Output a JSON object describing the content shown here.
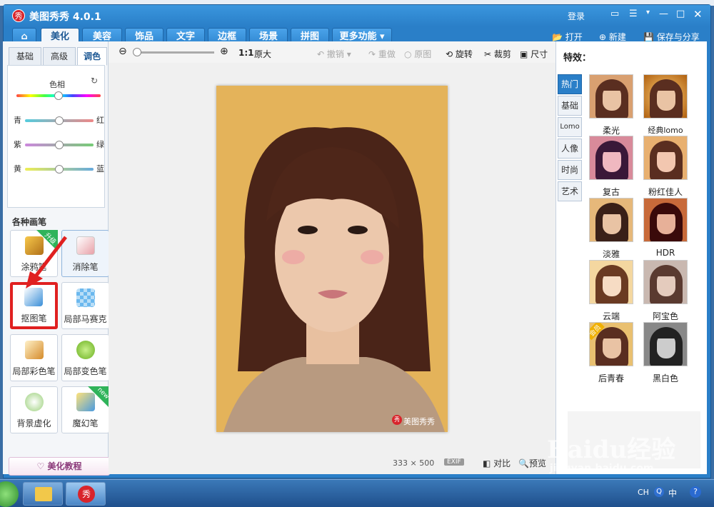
{
  "app": {
    "title": "美图秀秀 4.0.1",
    "logo_text": "秀",
    "login": "登录"
  },
  "tabs": [
    "美化",
    "美容",
    "饰品",
    "文字",
    "边框",
    "场景",
    "拼图",
    "更多功能"
  ],
  "toolbar": {
    "open": "打开",
    "new": "新建",
    "save": "保存与分享"
  },
  "left": {
    "subtabs": [
      "基础",
      "高级",
      "调色"
    ],
    "adjust": {
      "hue": "色相",
      "left1": "青",
      "right1": "红",
      "left2": "紫",
      "right2": "绿",
      "left3": "黄",
      "right3": "蓝"
    },
    "brush_title": "各种画笔",
    "brushes": [
      {
        "label": "涂鸦笔",
        "badge": "升级"
      },
      {
        "label": "消除笔",
        "badge": ""
      },
      {
        "label": "抠图笔",
        "badge": ""
      },
      {
        "label": "局部马赛克",
        "badge": ""
      },
      {
        "label": "局部彩色笔",
        "badge": ""
      },
      {
        "label": "局部变色笔",
        "badge": ""
      },
      {
        "label": "背景虚化",
        "badge": ""
      },
      {
        "label": "魔幻笔",
        "badge": "new"
      }
    ],
    "tutorial": "美化教程"
  },
  "canvas": {
    "zoom_ratio": "1:1",
    "zoom_label": "原大",
    "undo": "撤销",
    "redo": "重做",
    "original": "原图",
    "rotate": "旋转",
    "crop": "裁剪",
    "size": "尺寸",
    "photo_watermark": "美图秀秀",
    "width": "333",
    "x": "×",
    "height": "500",
    "exif": "EXIF",
    "compare": "对比",
    "preview": "预览"
  },
  "effects": {
    "title": "特效：",
    "categories": [
      "热门",
      "基础",
      "Lomo",
      "人像",
      "时尚",
      "艺术"
    ],
    "items": [
      "柔光",
      "经典lomo",
      "复古",
      "粉红佳人",
      "淡雅",
      "HDR",
      "云端",
      "阿宝色",
      "后青春",
      "黑白色"
    ],
    "badge": "会员"
  },
  "taskbar": {
    "lang": "CH",
    "ime": "中"
  },
  "watermark": {
    "brand": "Baidu经验",
    "url": "jingyan.baidu.com"
  },
  "colors": {
    "accent": "#2a7fc8",
    "highlight": "#e02020"
  }
}
